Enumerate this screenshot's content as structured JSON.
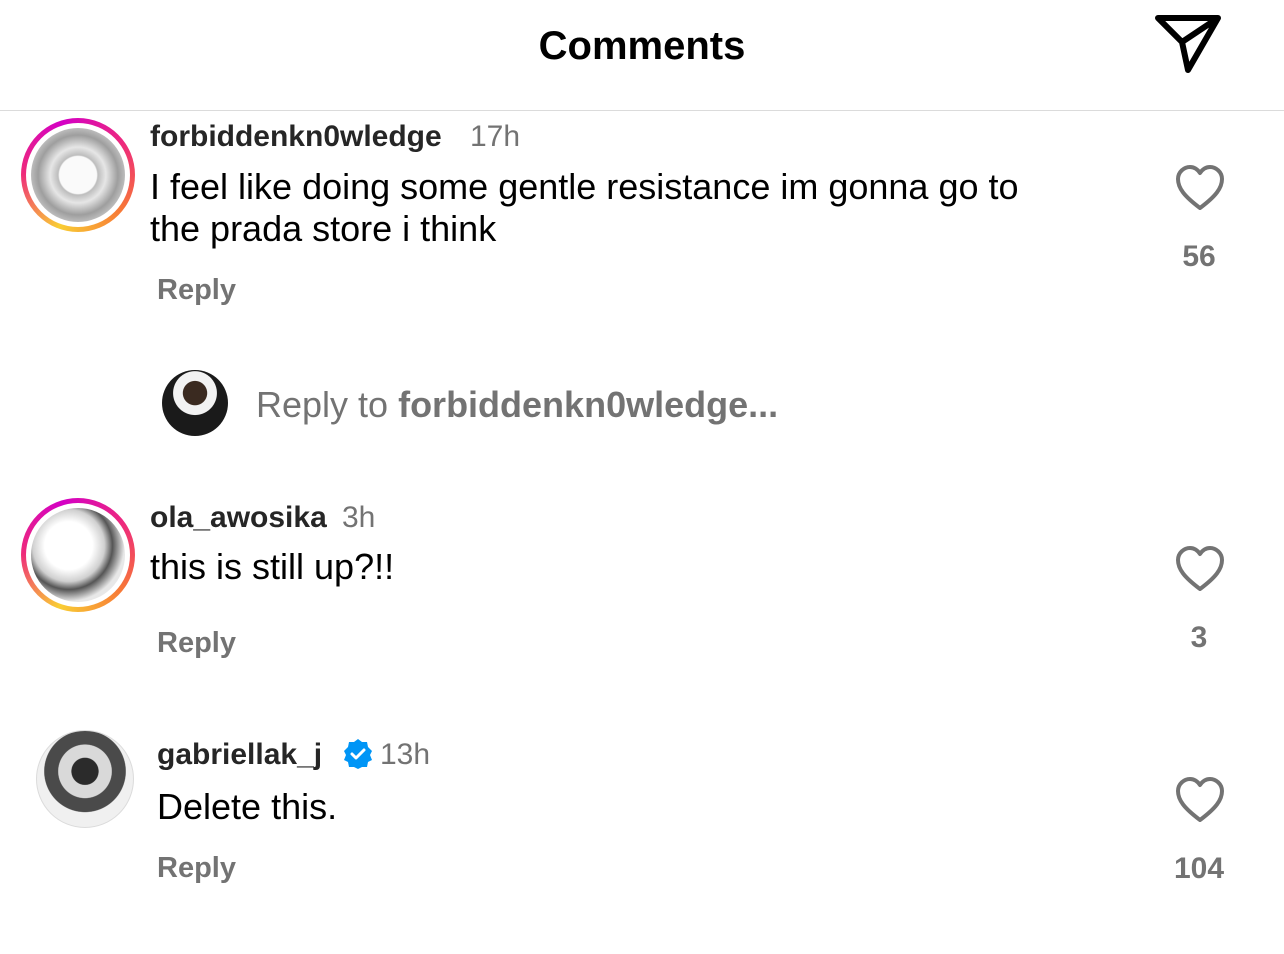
{
  "header": {
    "title": "Comments"
  },
  "comments": [
    {
      "username": "forbiddenkn0wledge",
      "time": "17h",
      "text_line1": "I feel like doing some gentle resistance im gonna go to",
      "text_line2": "the prada store i think",
      "reply_label": "Reply",
      "likes": "56"
    },
    {
      "username": "ola_awosika",
      "time": "3h",
      "text_line1": "this is still up?!!",
      "reply_label": "Reply",
      "likes": "3"
    },
    {
      "username": "gabriellak_j",
      "verified": true,
      "time": "13h",
      "text_line1": "Delete this.",
      "reply_label": "Reply",
      "likes": "104"
    }
  ],
  "reply_composer": {
    "prefix": "Reply to ",
    "target": "forbiddenkn0wledge..."
  },
  "colors": {
    "secondary_text": "#737373",
    "verified_blue": "#0095f6",
    "divider": "#dbdbdb"
  },
  "icons": [
    "send-icon",
    "heart-icon",
    "verified-badge-icon"
  ]
}
